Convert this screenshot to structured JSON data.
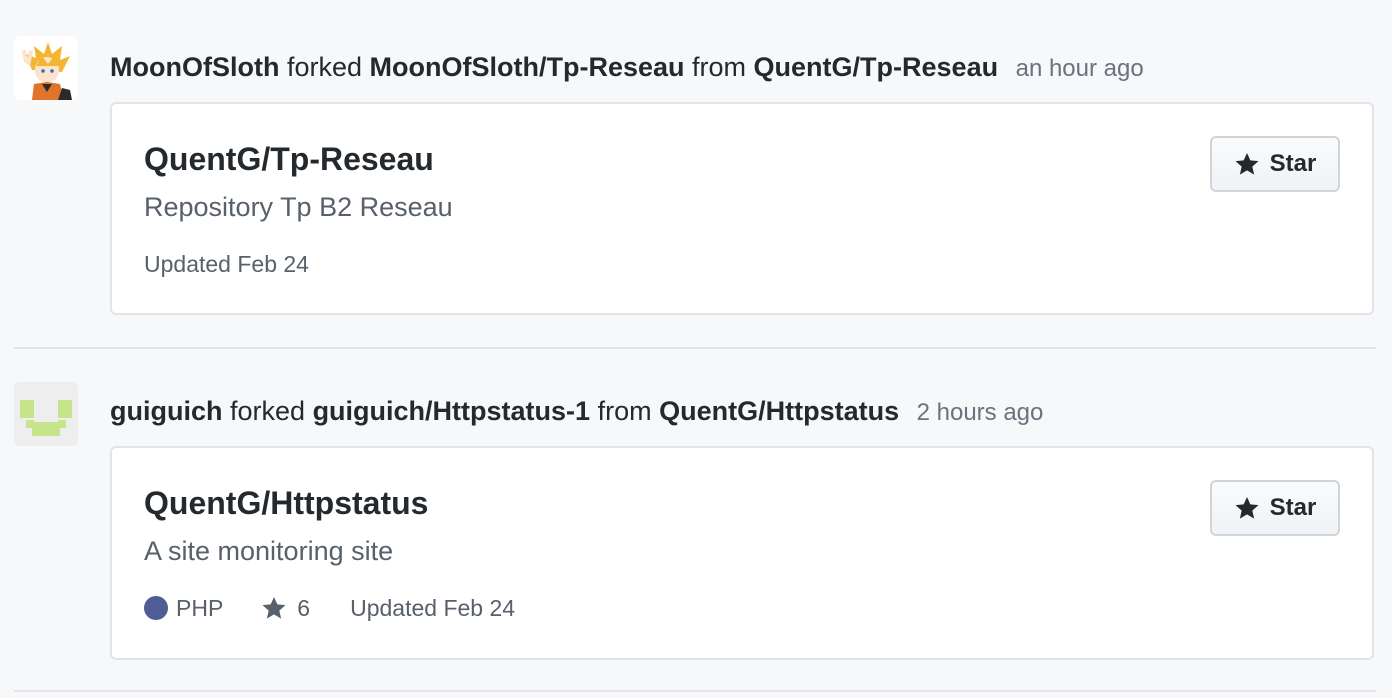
{
  "events": [
    {
      "actor": "MoonOfSloth",
      "action": "forked",
      "target": "MoonOfSloth/Tp-Reseau",
      "from_word": "from",
      "source": "QuentG/Tp-Reseau",
      "time": "an hour ago",
      "avatar_icon": "anime-avatar-icon",
      "repo": {
        "name": "QuentG/Tp-Reseau",
        "description": "Repository Tp B2 Reseau",
        "updated": "Updated Feb 24"
      },
      "star_label": "Star"
    },
    {
      "actor": "guiguich",
      "action": "forked",
      "target": "guiguich/Httpstatus-1",
      "from_word": "from",
      "source": "QuentG/Httpstatus",
      "time": "2 hours ago",
      "avatar_icon": "identicon-avatar-icon",
      "repo": {
        "name": "QuentG/Httpstatus",
        "description": "A site monitoring site",
        "language": "PHP",
        "language_color": "#4F5D95",
        "stars": "6",
        "updated": "Updated Feb 24"
      },
      "star_label": "Star"
    }
  ],
  "colors": {
    "background": "#f6f8fa",
    "text": "#24292e",
    "muted": "#586069",
    "time": "#6a737d",
    "border": "#e1e4e8",
    "identicon": "#c6e48b"
  }
}
